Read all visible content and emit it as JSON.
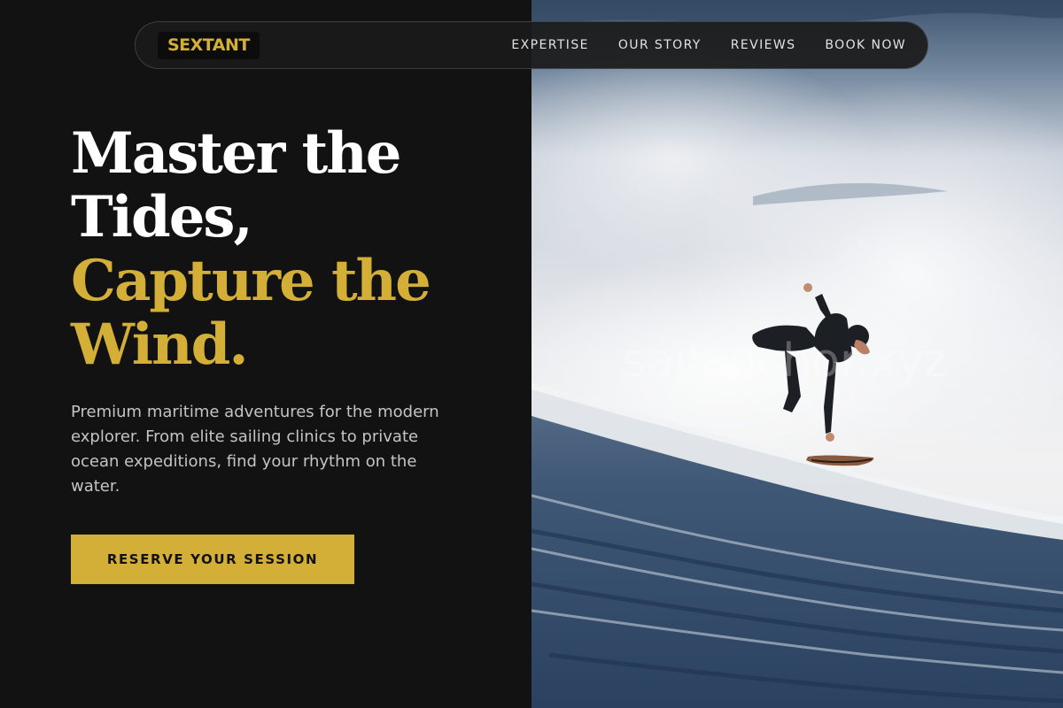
{
  "brand": {
    "logo": "SEXTANT"
  },
  "nav": {
    "items": [
      "EXPERTISE",
      "OUR STORY",
      "REVIEWS",
      "BOOK NOW"
    ]
  },
  "hero": {
    "title_line1": "Master the",
    "title_line2": "Tides,",
    "title_accent_line1": "Capture the",
    "title_accent_line2": "Wind.",
    "description": "Premium maritime adventures for the modern explorer. From elite sailing clinics to private ocean expeditions, find your rhythm on the water.",
    "cta_label": "RESERVE YOUR SESSION"
  },
  "photo": {
    "watermark": "sailanchor.xyz"
  },
  "colors": {
    "accent": "#d4af37",
    "background": "#121212",
    "text": "#ffffff",
    "muted_text": "#c4c4c4"
  }
}
